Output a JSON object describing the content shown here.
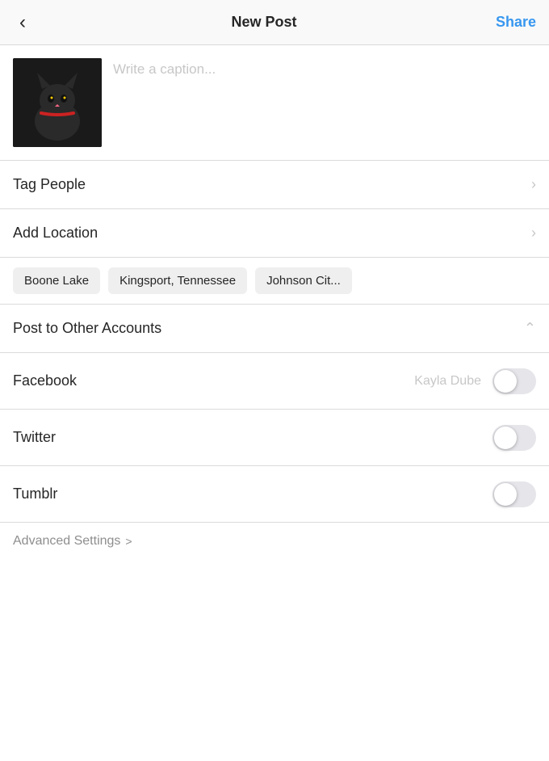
{
  "header": {
    "back_label": "<",
    "title": "New Post",
    "share_label": "Share"
  },
  "caption": {
    "placeholder": "Write a caption..."
  },
  "tag_people": {
    "label": "Tag People"
  },
  "add_location": {
    "label": "Add Location"
  },
  "location_chips": [
    {
      "label": "Boone Lake"
    },
    {
      "label": "Kingsport, Tennessee"
    },
    {
      "label": "Johnson Cit..."
    }
  ],
  "post_to_other_accounts": {
    "label": "Post to Other Accounts"
  },
  "accounts": [
    {
      "service": "Facebook",
      "account_name": "Kayla Dube",
      "enabled": false
    },
    {
      "service": "Twitter",
      "account_name": "",
      "enabled": false
    },
    {
      "service": "Tumblr",
      "account_name": "",
      "enabled": false
    }
  ],
  "advanced_settings": {
    "label": "Advanced Settings",
    "chevron": ">"
  },
  "colors": {
    "accent": "#3897f0",
    "divider": "#dbdbdb",
    "toggle_off": "#e5e5ea",
    "text_primary": "#262626",
    "text_muted": "#8e8e8e",
    "text_placeholder": "#c7c7c7"
  }
}
